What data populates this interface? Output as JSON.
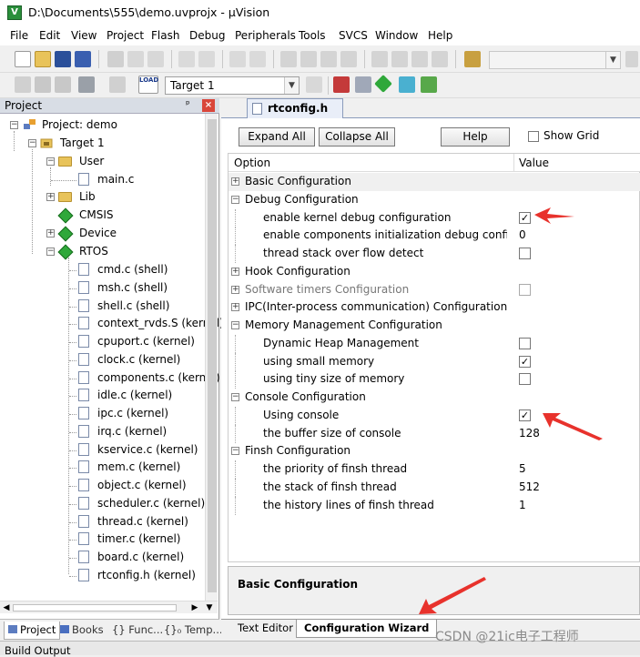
{
  "window": {
    "title": "D:\\Documents\\555\\demo.uvprojx - µVision"
  },
  "menu": [
    "File",
    "Edit",
    "View",
    "Project",
    "Flash",
    "Debug",
    "Peripherals",
    "Tools",
    "SVCS",
    "Window",
    "Help"
  ],
  "toolbar2": {
    "target_select": "Target 1",
    "load_label": "LOAD"
  },
  "project_panel": {
    "title": "Project",
    "root": "Project: demo",
    "target": "Target 1",
    "groups": {
      "user": "User",
      "lib": "Lib",
      "cmsis": "CMSIS",
      "device": "Device",
      "rtos": "RTOS"
    },
    "user_files": [
      "main.c"
    ],
    "rtos_files": [
      "cmd.c (shell)",
      "msh.c (shell)",
      "shell.c (shell)",
      "context_rvds.S (kernel)",
      "cpuport.c (kernel)",
      "clock.c (kernel)",
      "components.c (kernel)",
      "idle.c (kernel)",
      "ipc.c (kernel)",
      "irq.c (kernel)",
      "kservice.c (kernel)",
      "mem.c (kernel)",
      "object.c (kernel)",
      "scheduler.c (kernel)",
      "thread.c (kernel)",
      "timer.c (kernel)",
      "board.c (kernel)",
      "rtconfig.h (kernel)"
    ],
    "tabs": [
      "Project",
      "Books",
      "{} Func...",
      "{}₀ Temp..."
    ]
  },
  "editor": {
    "tab": "rtconfig.h",
    "buttons": {
      "expand_all": "Expand All",
      "collapse_all": "Collapse All",
      "help": "Help"
    },
    "show_grid": "Show Grid",
    "columns": {
      "option": "Option",
      "value": "Value"
    },
    "rows": [
      {
        "label": "Basic Configuration",
        "value": ""
      },
      {
        "label": "Debug Configuration",
        "value": ""
      },
      {
        "label": "enable kernel debug configuration",
        "value": "✓"
      },
      {
        "label": "enable components initialization debug configur...",
        "value": "0"
      },
      {
        "label": "thread stack over flow detect",
        "value": ""
      },
      {
        "label": "Hook Configuration",
        "value": ""
      },
      {
        "label": "Software timers Configuration",
        "value": ""
      },
      {
        "label": "IPC(Inter-process communication) Configuration",
        "value": ""
      },
      {
        "label": "Memory Management Configuration",
        "value": ""
      },
      {
        "label": "Dynamic Heap Management",
        "value": ""
      },
      {
        "label": "using small memory",
        "value": "✓"
      },
      {
        "label": "using tiny size of memory",
        "value": ""
      },
      {
        "label": "Console Configuration",
        "value": ""
      },
      {
        "label": "Using console",
        "value": "✓"
      },
      {
        "label": "the buffer size of console",
        "value": "128"
      },
      {
        "label": "Finsh Configuration",
        "value": ""
      },
      {
        "label": "the priority of finsh thread",
        "value": "5"
      },
      {
        "label": "the stack of finsh thread",
        "value": "512"
      },
      {
        "label": "the history lines of finsh thread",
        "value": "1"
      }
    ],
    "description": "Basic Configuration",
    "bottom_tabs": {
      "text_editor": "Text Editor",
      "config_wizard": "Configuration Wizard"
    }
  },
  "build_output": "Build Output",
  "watermark": "CSDN @21ic电子工程师",
  "colors": {
    "accent_red": "#e8322c",
    "check_green": "#2fa83a"
  }
}
